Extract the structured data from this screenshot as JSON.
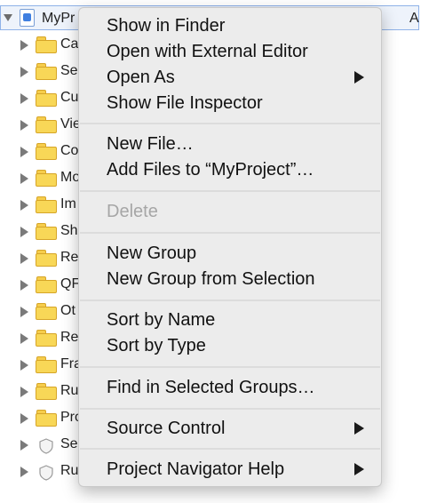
{
  "navigator": {
    "root": {
      "label": "MyPr",
      "right_label": "A"
    },
    "rows": [
      {
        "label": "Ca",
        "icon": "folder-icon"
      },
      {
        "label": "Se",
        "icon": "folder-icon"
      },
      {
        "label": "Cu",
        "icon": "folder-icon"
      },
      {
        "label": "Vie",
        "icon": "folder-icon"
      },
      {
        "label": "Co",
        "icon": "folder-icon"
      },
      {
        "label": "Mo",
        "icon": "folder-icon"
      },
      {
        "label": "Im",
        "icon": "folder-icon"
      },
      {
        "label": "Sh",
        "icon": "folder-icon"
      },
      {
        "label": "Re",
        "icon": "folder-icon"
      },
      {
        "label": "QF",
        "icon": "folder-icon"
      },
      {
        "label": "Ot",
        "icon": "folder-icon"
      },
      {
        "label": "Re",
        "icon": "folder-icon"
      },
      {
        "label": "Fra",
        "icon": "folder-icon"
      },
      {
        "label": "Ru",
        "icon": "folder-icon"
      },
      {
        "label": "Pro",
        "icon": "folder-icon"
      },
      {
        "label": "Se",
        "icon": "shield-icon"
      },
      {
        "label": "Ru",
        "icon": "shield-icon"
      }
    ]
  },
  "menu": {
    "items": [
      {
        "label": "Show in Finder"
      },
      {
        "label": "Open with External Editor"
      },
      {
        "label": "Open As",
        "submenu": true
      },
      {
        "label": "Show File Inspector"
      },
      {
        "label": "New File…"
      },
      {
        "label": "Add Files to “MyProject”…"
      },
      {
        "label": "Delete",
        "disabled": true
      },
      {
        "label": "New Group"
      },
      {
        "label": "New Group from Selection"
      },
      {
        "label": "Sort by Name"
      },
      {
        "label": "Sort by Type"
      },
      {
        "label": "Find in Selected Groups…"
      },
      {
        "label": "Source Control",
        "submenu": true
      },
      {
        "label": "Project Navigator Help",
        "submenu": true
      }
    ]
  },
  "colors": {
    "menu_background": "#ececec",
    "selection_border": "#8fb2e8",
    "folder": "#f8d757",
    "disabled_text": "#a6a6a6"
  }
}
